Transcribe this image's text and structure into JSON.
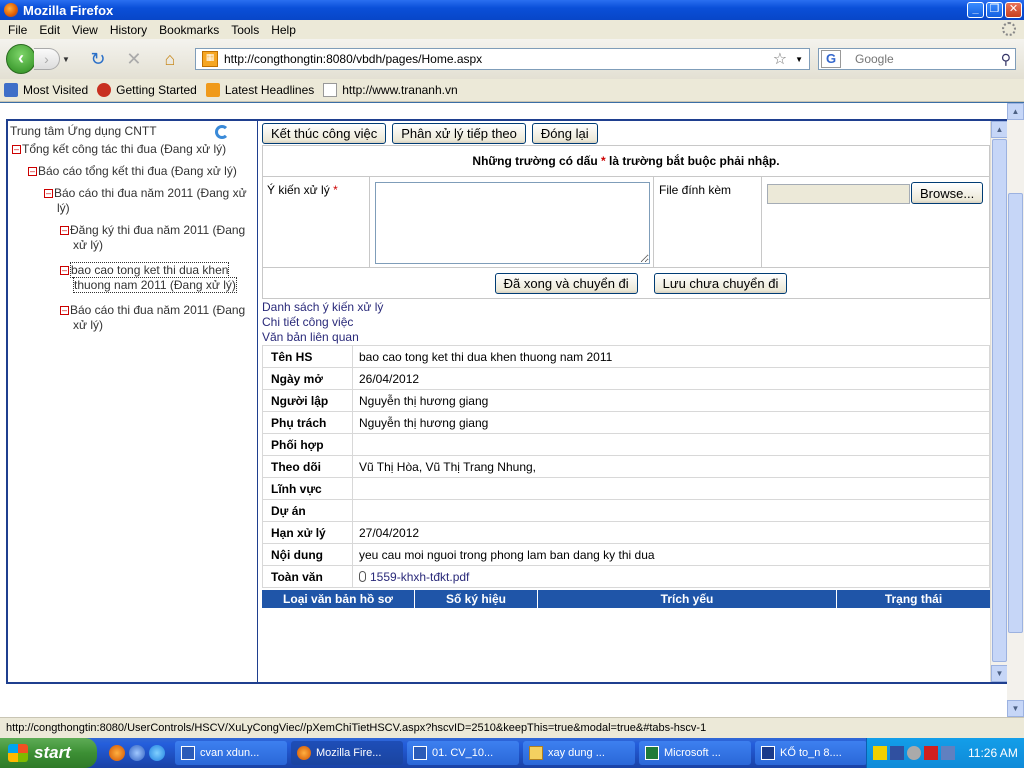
{
  "window": {
    "title": "Mozilla Firefox"
  },
  "menu": [
    "File",
    "Edit",
    "View",
    "History",
    "Bookmarks",
    "Tools",
    "Help"
  ],
  "nav": {
    "url": "http://congthongtin:8080/vbdh/pages/Home.aspx",
    "search_placeholder": "Google"
  },
  "bookmarks": [
    "Most Visited",
    "Getting Started",
    "Latest Headlines",
    "http://www.trananh.vn"
  ],
  "tree": {
    "root": "Trung tâm Ứng dụng CNTT",
    "nodes": [
      {
        "line1": "Tổng kết công tác thi đua (Đang xử lý)",
        "line2": ""
      },
      {
        "line1": "Báo cáo tổng kết thi đua (Đang xử lý)",
        "line2": ""
      },
      {
        "line1": "Báo cáo thi đua năm 2011 (Đang xử",
        "line2": "lý)"
      },
      {
        "line1": "Đăng ký thi đua năm 2011 (Đang",
        "line2": "xử lý)"
      },
      {
        "line1": "bao cao tong ket thi dua khen",
        "line2": "thuong nam 2011 (Đang xử lý)"
      },
      {
        "line1": "Báo cáo thi đua năm 2011 (Đang",
        "line2": "xử lý)"
      }
    ]
  },
  "actions": {
    "finish": "Kết thúc công việc",
    "forward": "Phân xử lý tiếp theo",
    "close": "Đóng lại"
  },
  "form": {
    "note_before": "Những trường có dấu ",
    "note_star": "*",
    "note_after": " là trường bắt buộc phải nhập.",
    "opinion_label": "Ý kiến xử lý ",
    "required_star": "*",
    "attach_label": "File đính kèm",
    "browse_label": "Browse...",
    "done_forward": "Đã xong và chuyển đi",
    "save_no_forward": "Lưu chưa chuyển đi"
  },
  "links": [
    "Danh sách ý kiến xử lý",
    "Chi tiết công việc",
    "Văn bản liên quan"
  ],
  "details": [
    {
      "key": "Tên HS",
      "value": "bao cao tong ket thi dua khen thuong nam 2011"
    },
    {
      "key": "Ngày mở",
      "value": "26/04/2012"
    },
    {
      "key": "Người lập",
      "value": "Nguyễn thị hương giang"
    },
    {
      "key": "Phụ trách",
      "value": "Nguyễn thị hương giang"
    },
    {
      "key": "Phối hợp",
      "value": ""
    },
    {
      "key": "Theo dõi",
      "value": "Vũ Thị Hòa, Vũ Thị Trang Nhung,"
    },
    {
      "key": "Lĩnh vực",
      "value": ""
    },
    {
      "key": "Dự án",
      "value": ""
    },
    {
      "key": "Hạn xử lý",
      "value": "27/04/2012"
    },
    {
      "key": "Nội dung",
      "value": "yeu cau moi nguoi trong phong lam ban dang ky thi dua"
    },
    {
      "key": "Toàn văn",
      "value": "1559-khxh-tđkt.pdf"
    }
  ],
  "grid_headers": [
    "Loại văn bản hồ sơ",
    "Số ký hiệu",
    "Trích yếu",
    "Trạng thái"
  ],
  "status_text": "http://congthongtin:8080/UserControls/HSCV/XuLyCongViec//pXemChiTietHSCV.aspx?hscvID=2510&keepThis=true&modal=true&#tabs-hscv-1",
  "taskbar": {
    "start": "start",
    "tasks": [
      "cvan xdun...",
      "Mozilla Fire...",
      "01. CV_10...",
      "xay dung ...",
      "Microsoft ...",
      "KỔ to_n 8...."
    ],
    "clock": "11:26 AM"
  }
}
